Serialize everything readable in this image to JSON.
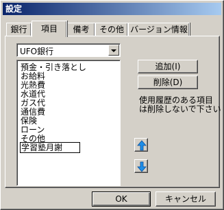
{
  "window": {
    "title": "設定"
  },
  "tabs": [
    {
      "label": "銀行"
    },
    {
      "label": "項目"
    },
    {
      "label": "備考"
    },
    {
      "label": "その他"
    },
    {
      "label": "バージョン情報"
    }
  ],
  "bank_select": {
    "value": "UFO銀行",
    "icon": "chevron-down-icon"
  },
  "items": [
    "預金・引き落とし",
    "お給料",
    "光熱費",
    "水道代",
    "ガス代",
    "通信費",
    "保険",
    "ローン",
    "その他",
    "学習塾月謝"
  ],
  "buttons": {
    "add": "追加(I)",
    "delete": "削除(D)",
    "ok": "OK",
    "cancel": "キャンセル"
  },
  "note": [
    "使用履歴のある項目",
    "は削除しないで下さい"
  ],
  "move_buttons": {
    "up_icon": "arrow-up-icon",
    "down_icon": "arrow-down-icon",
    "color": "#1e8ee8"
  }
}
